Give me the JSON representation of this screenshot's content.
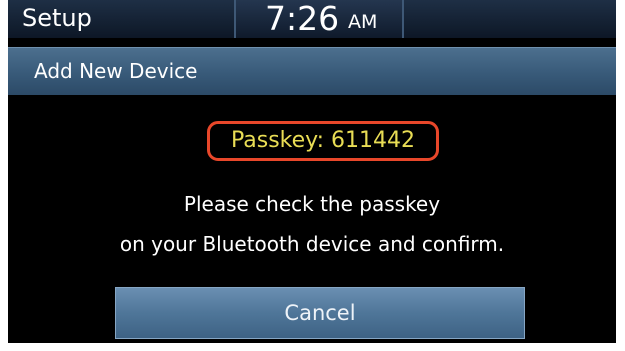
{
  "header": {
    "title": "Setup",
    "time": "7:26",
    "ampm": "AM"
  },
  "section": {
    "title": "Add New Device"
  },
  "passkey": {
    "text": "Passkey: 611442"
  },
  "message": {
    "line1": "Please check the passkey",
    "line2": "on your Bluetooth device and confirm."
  },
  "buttons": {
    "cancel_label": "Cancel"
  },
  "colors": {
    "passkey_text": "#e9dd55",
    "highlight_border": "#e8472a",
    "header_blue": "#385a79",
    "button_blue": "#4f7699"
  }
}
